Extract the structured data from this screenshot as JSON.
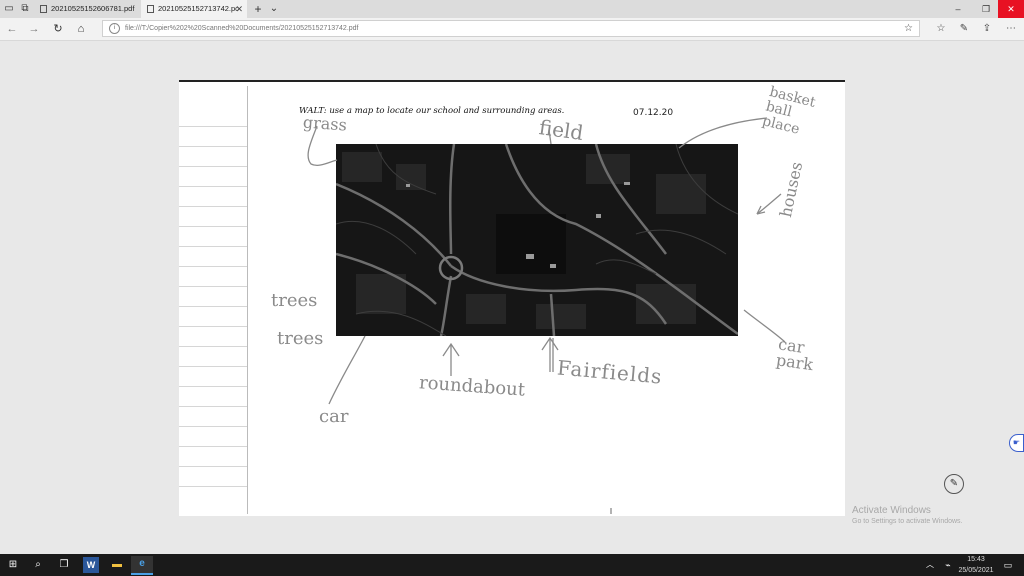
{
  "browser": {
    "tabs": [
      {
        "label": "20210525152606781.pdf",
        "active": false
      },
      {
        "label": "20210525152713742.pc",
        "active": true
      }
    ],
    "new_tab_glyph": "+",
    "tab_list_glyph": "⌄",
    "address_url": "file:///T:/Copier%202%20Scanned%20Documents/20210525152713742.pdf",
    "icons": [
      "tab-aside-icon",
      "tabs-preview-icon",
      "back-icon",
      "forward-icon",
      "refresh-icon",
      "home-icon",
      "info-icon",
      "favorite-star-icon",
      "favorites-hub-icon",
      "pen-icon",
      "share-icon",
      "more-icon",
      "minimize-icon",
      "restore-icon",
      "close-icon"
    ]
  },
  "document": {
    "walt": "WALT: use a map to locate our school and surrounding areas.",
    "date": "07.12.20",
    "handwriting": {
      "grass": "grass",
      "field": "field",
      "basketball": "basket ball place",
      "houses": "houses",
      "trees1": "trees",
      "trees2": "trees",
      "roundabout": "roundabout",
      "fairfields": "Fairfields",
      "carpark": "car park",
      "car": "car"
    }
  },
  "overlay": {
    "activate_title": "Activate Windows",
    "activate_sub": "Go to Settings to activate Windows."
  },
  "taskbar": {
    "time": "15:43",
    "date": "25/05/2021",
    "icons": [
      "windows-start-icon",
      "search-icon",
      "task-view-icon",
      "word-icon",
      "file-explorer-icon",
      "edge-icon",
      "chevron-up-icon",
      "network-icon",
      "notification-icon"
    ]
  },
  "colors": {
    "close_red": "#e81123",
    "taskbar": "#1a1a1a",
    "pencil": "#8a8a8a"
  }
}
